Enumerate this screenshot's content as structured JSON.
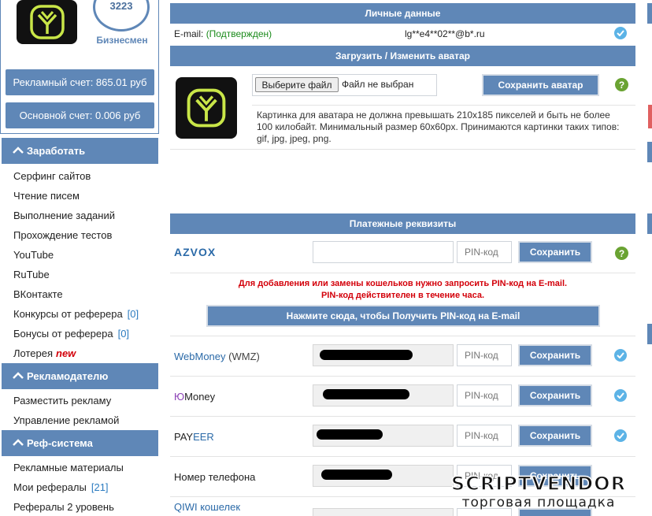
{
  "sidebar": {
    "rating": "3223",
    "status": "Бизнесмен",
    "ad_account": "Рекламный счет: 865.01 руб",
    "main_account": "Основной счет: 0.006 руб",
    "sections": [
      {
        "title": "Заработать",
        "items": [
          {
            "label": "Серфинг сайтов"
          },
          {
            "label": "Чтение писем"
          },
          {
            "label": "Выполнение заданий"
          },
          {
            "label": "Прохождение тестов"
          },
          {
            "label": "YouTube"
          },
          {
            "label": "RuTube"
          },
          {
            "label": "ВКонтакте"
          },
          {
            "label": "Конкурсы от реферера",
            "count": "[0]"
          },
          {
            "label": "Бонусы от реферера",
            "count": "[0]"
          },
          {
            "label": "Лотерея",
            "badge": "new"
          }
        ]
      },
      {
        "title": "Рекламодателю",
        "items": [
          {
            "label": "Разместить рекламу"
          },
          {
            "label": "Управление рекламой"
          }
        ]
      },
      {
        "title": "Реф-система",
        "items": [
          {
            "label": "Рекламные материалы"
          },
          {
            "label": "Мои рефералы",
            "count": "[21]"
          },
          {
            "label": "Рефералы 2 уровень"
          }
        ]
      }
    ]
  },
  "personal": {
    "title": "Личные данные",
    "email_label": "E-mail:",
    "email_status": "(Подтвержден)",
    "email_value": "lg**e4**02**@b*.ru"
  },
  "avatar": {
    "title": "Загрузить / Изменить аватар",
    "choose_file": "Выберите файл",
    "no_file": "Файл не выбран",
    "save": "Сохранить аватар",
    "help": "?",
    "note": "Картинка для аватара не должна превышать 210x185 пикселей и быть не более 100 килобайт. Минимальный размер 60x60px. Принимаются картинки таких типов: gif, jpg, jpeg, png."
  },
  "payments": {
    "title": "Платежные реквизиты",
    "pin_placeholder": "PIN-код",
    "save": "Сохранить",
    "help": "?",
    "warning_line1": "Для добавления или замены кошельков нужно запросить PIN-код на E-mail.",
    "warning_line2": "PIN-код действителен в течение часа.",
    "get_pin": "Нажмите сюда, чтобы Получить PIN-код на E-mail",
    "azvox": "AZVOX",
    "webmoney": {
      "name": "WebMoney",
      "suffix": "(WMZ)"
    },
    "yoomoney": {
      "prefix": "Ю",
      "name": "Money"
    },
    "payeer": {
      "prefix": "PAY",
      "name": "EER"
    },
    "phone": "Номер телефона",
    "qiwi": "QIWI кошелек"
  },
  "watermark": {
    "top": "SCRIPTVENDOR",
    "bottom": "торговая площадка"
  },
  "colors": {
    "accent": "#5f87b7",
    "confirmed": "#1a8a1a",
    "warning": "#d3000a",
    "link": "#2b7bc0"
  }
}
